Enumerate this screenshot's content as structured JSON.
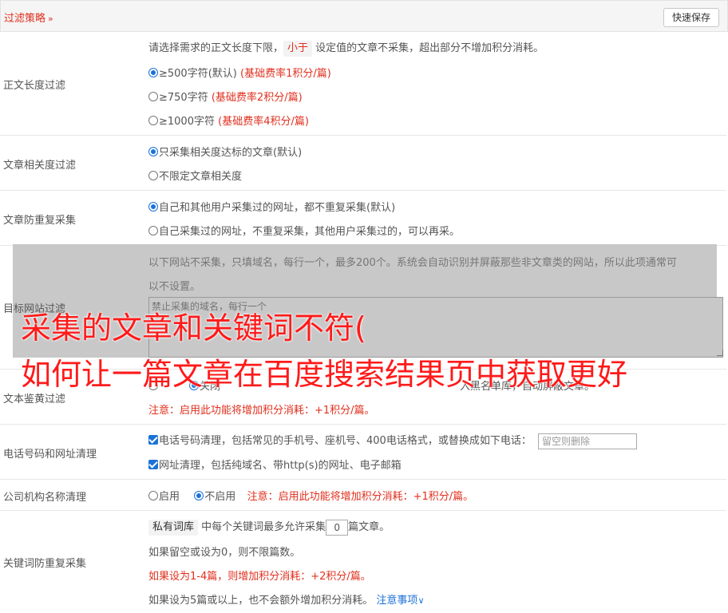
{
  "header": {
    "title": "过滤策略",
    "save_label": "快速保存"
  },
  "length_filter": {
    "label": "正文长度过滤",
    "desc_pre": "请选择需求的正文长度下限，",
    "desc_tag": "小于",
    "desc_post": "设定值的文章不采集，超出部分不增加积分消耗。",
    "options": [
      {
        "text": "≥500字符(默认)",
        "note": "(基础费率1积分/篇)"
      },
      {
        "text": "≥750字符",
        "note": "(基础费率2积分/篇)"
      },
      {
        "text": "≥1000字符",
        "note": "(基础费率4积分/篇)"
      }
    ]
  },
  "relevance_filter": {
    "label": "文章相关度过滤",
    "options": [
      "只采集相关度达标的文章(默认)",
      "不限定文章相关度"
    ]
  },
  "dedup": {
    "label": "文章防重复采集",
    "options": [
      "自己和其他用户采集过的网址，都不重复采集(默认)",
      "自己采集过的网址，不重复采集，其他用户采集过的，可以再采。"
    ]
  },
  "site_filter": {
    "label": "目标网站过滤",
    "desc_line1": "以下网站不采集，只填域名，每行一个，最多200个。系统会自动识别并屏蔽那些非文章类的网站，所以此项通常可",
    "desc_line2": "以不设置。",
    "placeholder": "禁止采集的域名，每行一个"
  },
  "porn_filter": {
    "label": "文本鉴黄过滤",
    "visible_fragment": "关闭",
    "visible_tail": "入黑名单库，自动屏蔽文章。",
    "note": "注意：启用此功能将增加积分消耗：+1积分/篇。"
  },
  "phone_cleanup": {
    "label": "电话号码和网址清理",
    "phone_text": "电话号码清理，包括常见的手机号、座机号、400电话格式，或替换成如下电话：",
    "phone_placeholder": "留空则删除",
    "url_text": "网址清理，包括纯域名、带http(s)的网址、电子邮箱"
  },
  "org_cleanup": {
    "label": "公司机构名称清理",
    "on_text": "启用",
    "off_text": "不启用",
    "note": "注意：启用此功能将增加积分消耗：+1积分/篇。"
  },
  "keyword_dedup": {
    "label": "关键词防重复采集",
    "tag": "私有词库",
    "line1_mid": "中每个关键词最多允许采集",
    "value": "0",
    "line1_post": "篇文章。",
    "line2": "如果留空或设为0，则不限篇数。",
    "line3": "如果设为1-4篇，则增加积分消耗：+2积分/篇。",
    "line4": "如果设为5篇或以上，也不会额外增加积分消耗。",
    "link": "注意事项"
  },
  "overlay": {
    "line1": "采集的文章和关键词不符(",
    "line2": "如何让一篇文章在百度搜索结果页中获取更好"
  },
  "colors": {
    "accent_red": "#e0301e",
    "accent_blue": "#1b72d8",
    "overlay_red": "#ff1a1a"
  }
}
